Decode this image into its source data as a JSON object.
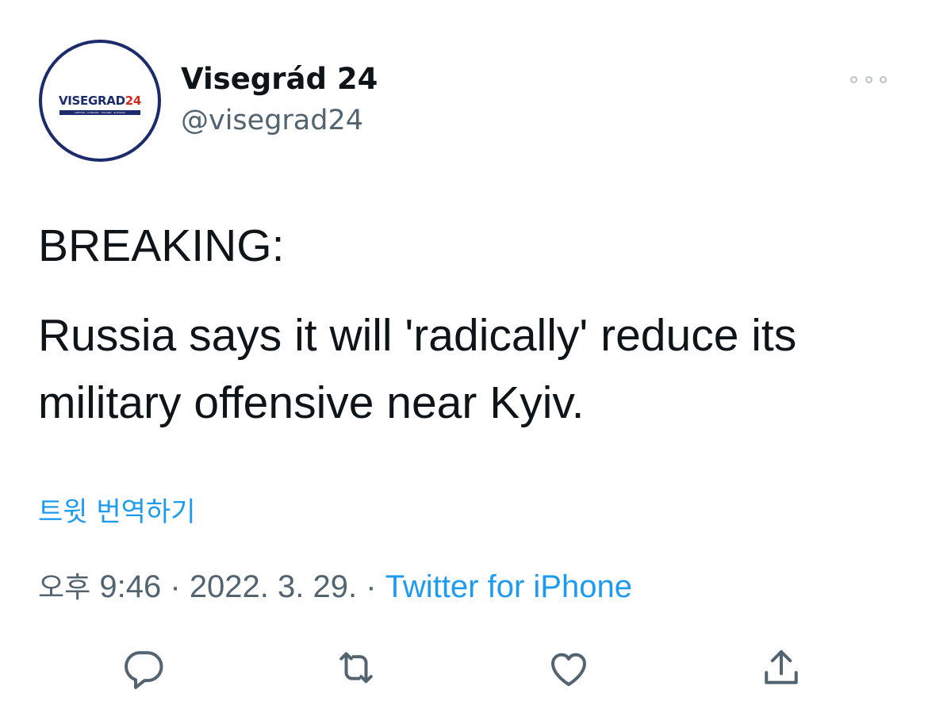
{
  "author": {
    "avatar_text_main": "VISEGRAD",
    "avatar_text_number": "24",
    "avatar_subtext": "CZECHIA · HUNGARY · POLAND · SLOVAKIA",
    "display_name": "Visegrád 24",
    "handle": "@visegrad24"
  },
  "tweet": {
    "line1": "BREAKING:",
    "line2": "Russia says it will 'radically' reduce its",
    "line3": "military offensive near Kyiv.",
    "translate_label": "트윗 번역하기"
  },
  "meta": {
    "ampm": "오후",
    "time": "9:46",
    "separator": "·",
    "date": "2022. 3. 29.",
    "source": "Twitter for iPhone"
  },
  "actions": {
    "reply_icon": "reply-icon",
    "retweet_icon": "retweet-icon",
    "like_icon": "heart-icon",
    "share_icon": "share-icon"
  },
  "colors": {
    "link": "#1d9bf0",
    "secondary_text": "#536471",
    "primary_text": "#0f1419",
    "icon": "#536471",
    "brand_navy": "#1b2b6b",
    "brand_red": "#d52b1e"
  }
}
